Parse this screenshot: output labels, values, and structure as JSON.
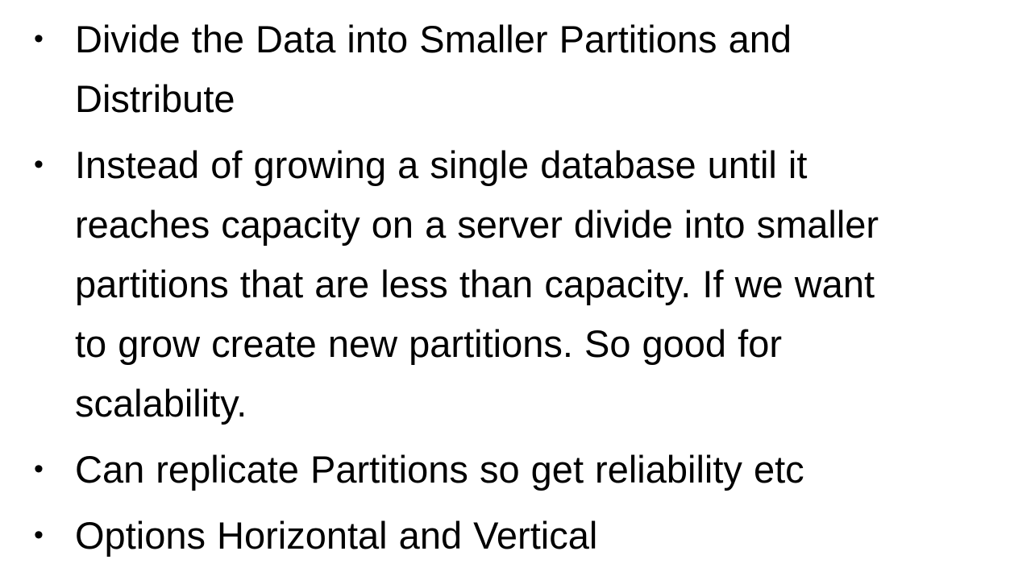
{
  "bullets": [
    {
      "marker": "•",
      "lines": [
        "Divide the Data into Smaller Partitions and",
        "Distribute"
      ]
    },
    {
      "marker": "•",
      "lines": [
        "Instead of growing a single database until it",
        "reaches capacity on a server divide into smaller",
        "partitions that are less than capacity. If we want",
        "to grow create new partitions. So good for",
        "scalability."
      ]
    },
    {
      "marker": "•",
      "lines": [
        "Can replicate Partitions so get reliability etc"
      ]
    },
    {
      "marker": "•",
      "lines": [
        "Options Horizontal and Vertical"
      ]
    }
  ]
}
